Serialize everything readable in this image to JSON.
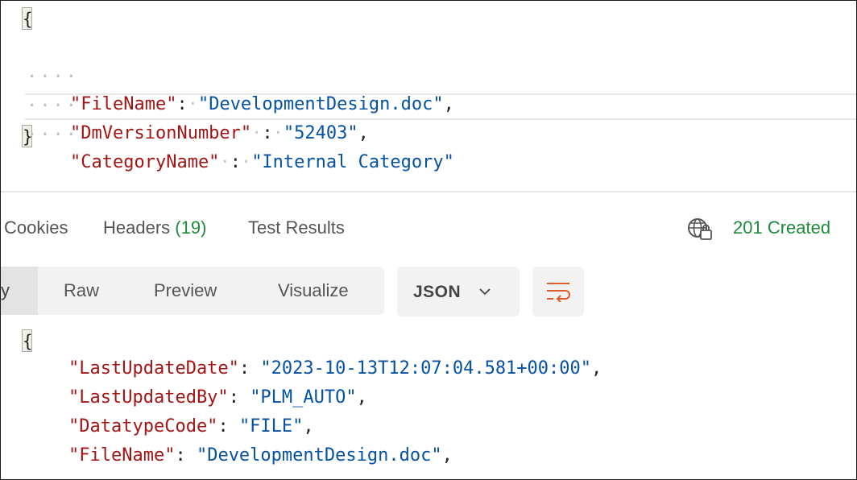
{
  "request_body": {
    "open_brace": "{",
    "close_brace": "}",
    "lines": [
      {
        "key": "\"FileName\"",
        "value": "\"DevelopmentDesign.doc\"",
        "trail": ","
      },
      {
        "key": "\"DmVersionNumber\"",
        "value": "\"52403\"",
        "trail": ","
      },
      {
        "key": "\"CategoryName\"",
        "value": "\"Internal Category\"",
        "trail": ""
      }
    ]
  },
  "response_tabs": {
    "cookies": "Cookies",
    "headers_label": "Headers",
    "headers_count": "(19)",
    "test_results": "Test Results"
  },
  "status": {
    "text": "201 Created",
    "color": "#1f8a3b",
    "icon": "globe-lock-icon"
  },
  "view_modes": {
    "pretty_partial": "y",
    "raw": "Raw",
    "preview": "Preview",
    "visualize": "Visualize"
  },
  "format_select": {
    "selected": "JSON",
    "icon": "chevron-down-icon"
  },
  "wrap_button": {
    "icon": "wrap-lines-icon",
    "color": "#e05a2b"
  },
  "response_body": {
    "open_brace": "{",
    "lines": [
      {
        "key": "\"LastUpdateDate\"",
        "value": "\"2023-10-13T12:07:04.581+00:00\"",
        "trail": ","
      },
      {
        "key": "\"LastUpdatedBy\"",
        "value": "\"PLM_AUTO\"",
        "trail": ","
      },
      {
        "key": "\"DatatypeCode\"",
        "value": "\"FILE\"",
        "trail": ","
      },
      {
        "key": "\"FileName\"",
        "value": "\"DevelopmentDesign.doc\"",
        "trail": ","
      }
    ]
  }
}
